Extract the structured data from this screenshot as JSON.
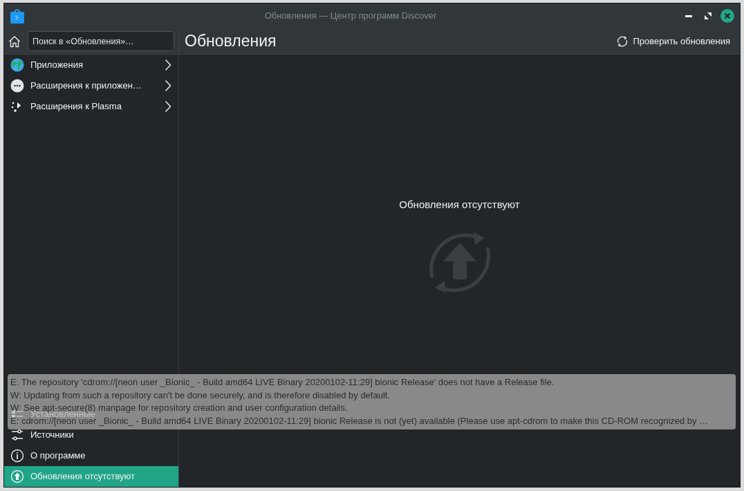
{
  "window": {
    "title": "Обновления — Центр программ Discover"
  },
  "search": {
    "placeholder": "Поиск в «Обновления»…"
  },
  "categories": [
    {
      "label": "Приложения",
      "kind": "globe"
    },
    {
      "label": "Расширения к приложен…",
      "kind": "addons"
    },
    {
      "label": "Расширения к Plasma",
      "kind": "plasma"
    }
  ],
  "bottom_nav": [
    {
      "label": "Установленные",
      "kind": "installed",
      "selected": false
    },
    {
      "label": "Источники",
      "kind": "sources",
      "selected": false
    },
    {
      "label": "О программе",
      "kind": "about",
      "selected": false
    },
    {
      "label": "Обновления отсутствуют",
      "kind": "updates",
      "selected": true
    }
  ],
  "page_title": "Обновления",
  "check_button": "Проверить обновления",
  "empty_state": {
    "message": "Обновления отсутствуют"
  },
  "notification": {
    "lines": [
      "E: The repository 'cdrom://[neon user _Bionic_ - Build amd64 LIVE Binary 20200102-11:29] bionic Release' does not have a Release file.",
      "W: Updating from such a repository can't be done securely, and is therefore disabled by default.",
      "W: See apt-secure(8) manpage for repository creation and user configuration details.",
      "E: cdrom://[neon user _Bionic_ - Build amd64 LIVE Binary 20200102-11:29] bionic Release is not (yet) available (Please use apt-cdrom to make this CD-ROM recognized by …"
    ]
  }
}
